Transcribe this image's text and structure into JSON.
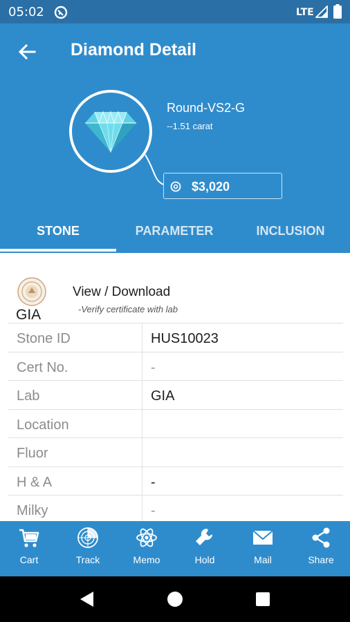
{
  "status_bar": {
    "time": "05:02",
    "network": "LTE"
  },
  "app_bar": {
    "title": "Diamond Detail",
    "back_icon": "arrow-back-icon"
  },
  "stone": {
    "title": "Round-VS2-G",
    "carat": "--1.51 carat",
    "price": "$3,020"
  },
  "tabs": [
    {
      "label": "STONE",
      "active": true
    },
    {
      "label": "PARAMETER",
      "active": false
    },
    {
      "label": "INCLUSION",
      "active": false
    }
  ],
  "certificate": {
    "lab": "GIA",
    "action": "View / Download",
    "hint": "-Verify certificate with lab"
  },
  "details": [
    {
      "label": "Stone ID",
      "value": "HUS10023"
    },
    {
      "label": "Cert No.",
      "value": "-"
    },
    {
      "label": "Lab",
      "value": "GIA"
    },
    {
      "label": "Location",
      "value": ""
    },
    {
      "label": "Fluor",
      "value": ""
    },
    {
      "label": "H & A",
      "value": "-"
    },
    {
      "label": "Milky",
      "value": "-"
    }
  ],
  "bottom_nav": [
    {
      "label": "Cart",
      "icon": "cart-icon"
    },
    {
      "label": "Track",
      "icon": "radar-icon"
    },
    {
      "label": "Memo",
      "icon": "atom-icon"
    },
    {
      "label": "Hold",
      "icon": "wrench-icon"
    },
    {
      "label": "Mail",
      "icon": "mail-icon"
    },
    {
      "label": "Share",
      "icon": "share-icon"
    }
  ],
  "colors": {
    "primary": "#2f8ccc",
    "status_bar": "#2a6fa6"
  }
}
